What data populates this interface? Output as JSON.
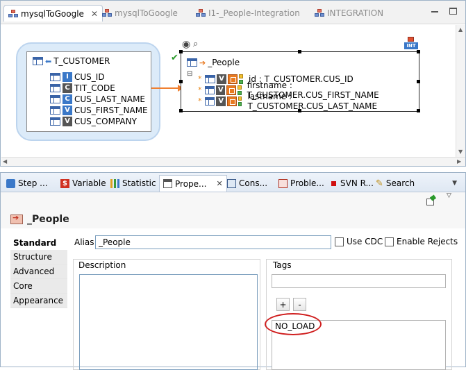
{
  "editor": {
    "tabs": [
      {
        "label": "mysqlToGoogle",
        "active": true
      },
      {
        "label": "mysqlToGoogle",
        "active": false
      },
      {
        "label": "I1-_People-Integration",
        "active": false
      },
      {
        "label": "INTEGRATION",
        "active": false
      }
    ],
    "close_glyph": "✕"
  },
  "diagram": {
    "source": {
      "name": "T_CUSTOMER",
      "columns": [
        {
          "name": "CUS_ID",
          "type": "I"
        },
        {
          "name": "TIT_CODE",
          "type": "C"
        },
        {
          "name": "CUS_LAST_NAME",
          "type": "C"
        },
        {
          "name": "CUS_FIRST_NAME",
          "type": "V"
        },
        {
          "name": "CUS_COMPANY",
          "type": "V"
        }
      ]
    },
    "target": {
      "name": "_People",
      "collapse_glyph": "⊟",
      "mappings": [
        {
          "expr": "id : T_CUSTOMER.CUS_ID"
        },
        {
          "expr": "firstname : T_CUSTOMER.CUS_FIRST_NAME"
        },
        {
          "expr": "lastname : T_CUSTOMER.CUS_LAST_NAME"
        }
      ],
      "int_badge": "INT"
    }
  },
  "views": {
    "tabs": [
      {
        "label": "Step ..."
      },
      {
        "label": "Variable"
      },
      {
        "label": "Statistic"
      },
      {
        "label": "Prope...",
        "active": true
      },
      {
        "label": "Cons..."
      },
      {
        "label": "Proble..."
      },
      {
        "label": "SVN R..."
      },
      {
        "label": "Search"
      }
    ],
    "close_glyph": "✕"
  },
  "properties": {
    "object_name": "_People",
    "categories": [
      "Standard",
      "Structure",
      "Advanced",
      "Core",
      "Appearance"
    ],
    "active_category": "Standard",
    "alias_label": "Alias",
    "alias_value": "_People",
    "use_cdc_label": "Use CDC",
    "enable_rejects_label": "Enable Rejects",
    "description_label": "Description",
    "tags_label": "Tags",
    "plus_label": "+",
    "minus_label": "-",
    "tags": [
      "NO_LOAD"
    ]
  },
  "colors": {
    "accent": "#3a78c8",
    "highlight": "#d02020",
    "mapping_arrow": "#f08030"
  }
}
